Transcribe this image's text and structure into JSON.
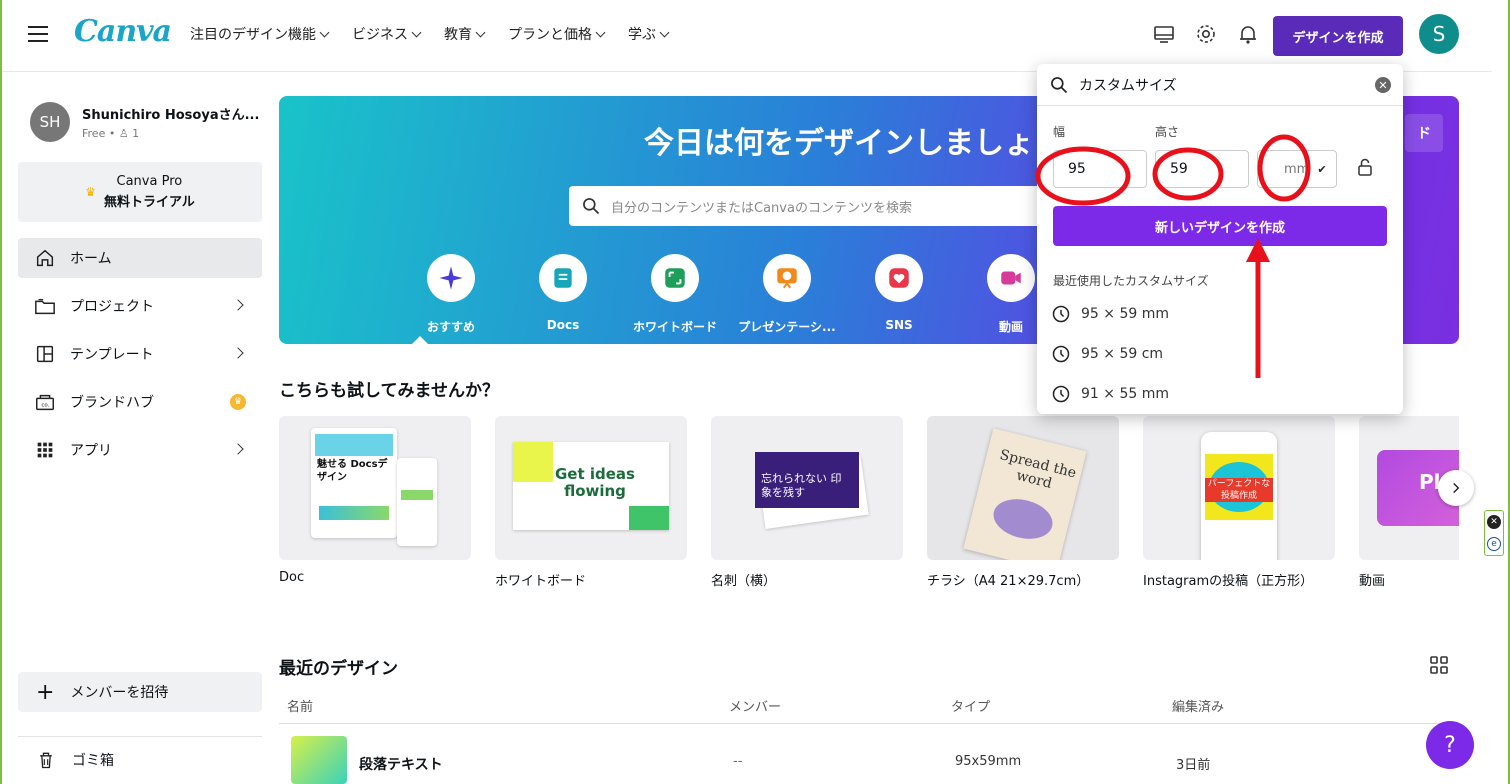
{
  "header": {
    "logo": "Canva",
    "nav": [
      "注目のデザイン機能",
      "ビジネス",
      "教育",
      "プランと価格",
      "学ぶ"
    ],
    "create_button": "デザインを作成",
    "avatar_letter": "S"
  },
  "sidebar": {
    "user_initials": "SH",
    "user_name": "Shunichiro Hosoyaさん...",
    "user_plan": "Free • ♙ 1",
    "pro_line1": "Canva Pro",
    "pro_line2": "無料トライアル",
    "items": [
      {
        "label": "ホーム"
      },
      {
        "label": "プロジェクト"
      },
      {
        "label": "テンプレート"
      },
      {
        "label": "ブランドハブ"
      },
      {
        "label": "アプリ"
      }
    ],
    "invite": "メンバーを招待",
    "trash": "ゴミ箱"
  },
  "hero": {
    "title": "今日は何をデザインしましょ",
    "upload_fragment": "ド",
    "search_placeholder": "自分のコンテンツまたはCanvaのコンテンツを検索",
    "categories": [
      "おすすめ",
      "Docs",
      "ホワイトボード",
      "プレゼンテーシ...",
      "SNS",
      "動画"
    ]
  },
  "try_section": {
    "title": "こちらも試してみませんか？",
    "cards": [
      {
        "label": "Doc",
        "thumb_text": "魅せる Docsデザイン"
      },
      {
        "label": "ホワイトボード",
        "thumb_text": "Get ideas flowing"
      },
      {
        "label": "名刺（横）",
        "thumb_text": "忘れられない 印象を残す"
      },
      {
        "label": "チラシ（A4 21×29.7cm）",
        "thumb_text": "Spread the word"
      },
      {
        "label": "Instagramの投稿（正方形）",
        "thumb_text": "パーフェクトな 投稿作成"
      },
      {
        "label": "動画",
        "thumb_text": "Pl"
      }
    ]
  },
  "recent": {
    "title": "最近のデザイン",
    "columns": [
      "名前",
      "メンバー",
      "タイプ",
      "編集済み"
    ],
    "rows": [
      {
        "name": "段落テキスト",
        "members": "--",
        "type": "95x59mm",
        "edited": "3日前"
      }
    ]
  },
  "popover": {
    "search_value": "カスタムサイズ",
    "width_label": "幅",
    "height_label": "高さ",
    "width_value": "95",
    "height_value": "59",
    "unit": "mm",
    "create_button": "新しいデザインを作成",
    "recent_title": "最近使用したカスタムサイズ",
    "recent_sizes": [
      "95 × 59 mm",
      "95 × 59 cm",
      "91 × 55 mm"
    ]
  },
  "help_label": "?",
  "colors": {
    "brand_purple": "#7d2ae8",
    "create_purple": "#5a2ab8",
    "annotation_red": "#e8101a"
  }
}
